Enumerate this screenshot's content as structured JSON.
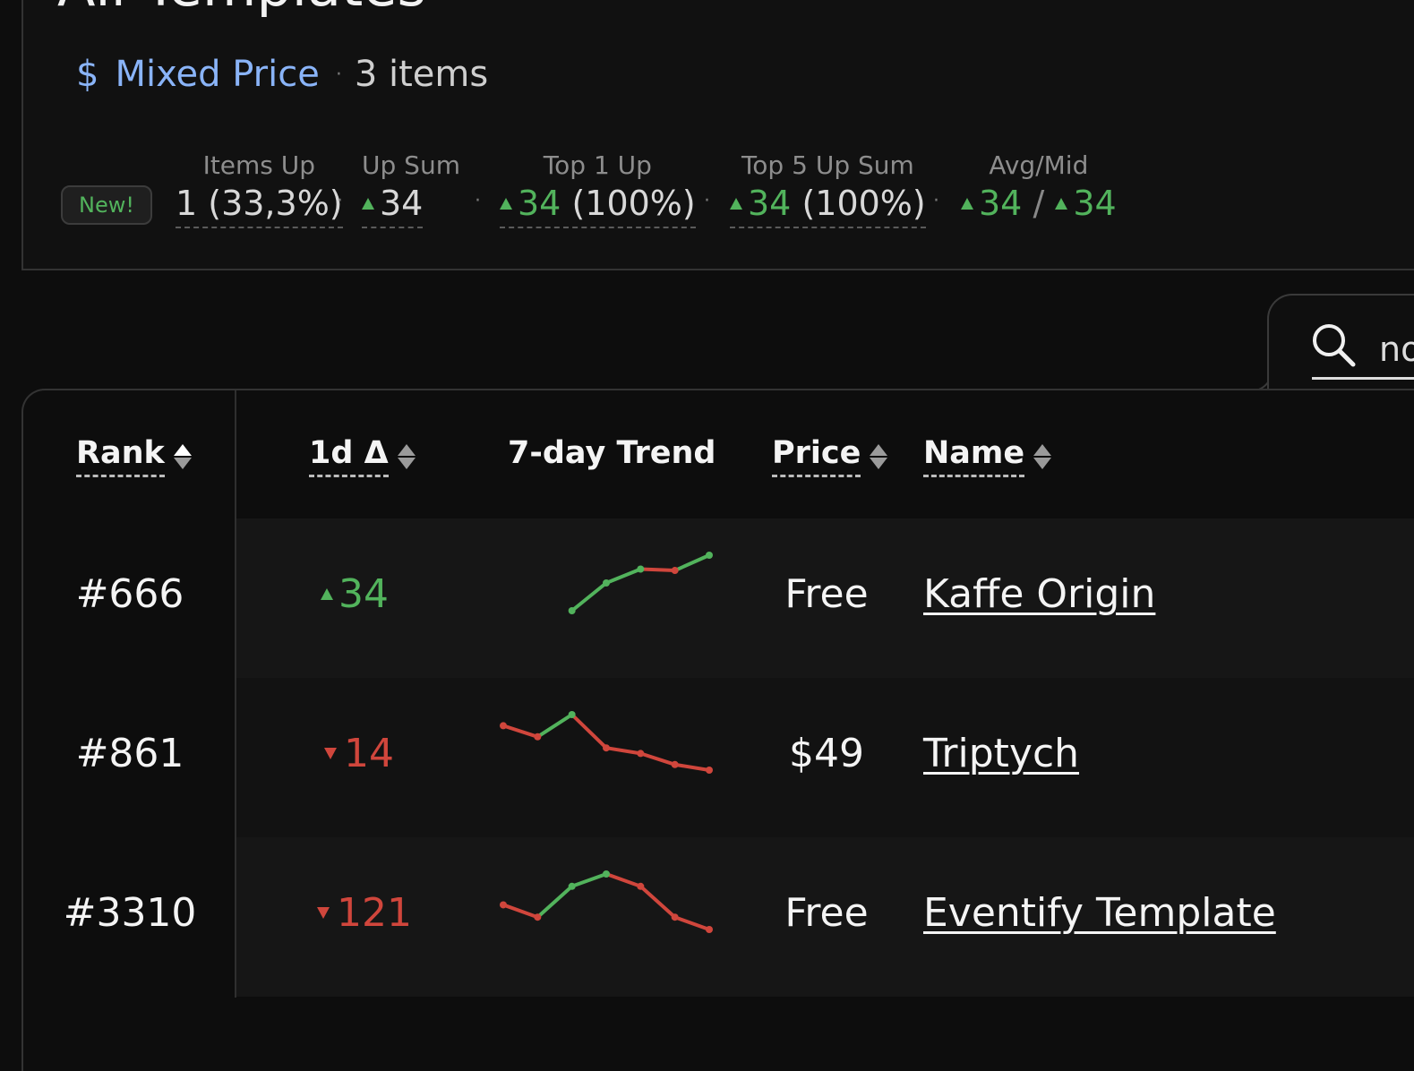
{
  "header": {
    "title": "All Templates",
    "price_icon": "$",
    "price_type": "Mixed Price",
    "separator": "·",
    "item_count": "3 items"
  },
  "badge": {
    "label": "New!"
  },
  "stats": [
    {
      "label": "Items Up",
      "value": "1 (33,3%)"
    },
    {
      "label": "Up Sum",
      "value": "34"
    },
    {
      "label": "Top 1 Up",
      "value": "34",
      "pct": "(100%)"
    },
    {
      "label": "Top 5 Up Sum",
      "value": "34",
      "pct": "(100%)"
    },
    {
      "label": "Avg/Mid",
      "avg": "34",
      "slash": "/",
      "mid": "34"
    }
  ],
  "search": {
    "value": "no",
    "icon": "search-icon"
  },
  "table": {
    "columns": [
      "Rank",
      "1d Δ",
      "7-day Trend",
      "Price",
      "Name"
    ],
    "rows": [
      {
        "rank": "#666",
        "delta": "34",
        "delta_dir": "up",
        "price": "Free",
        "name": "Kaffe Origin",
        "trend": [
          null,
          null,
          1,
          3,
          4,
          3.9,
          5
        ]
      },
      {
        "rank": "#861",
        "delta": "14",
        "delta_dir": "down",
        "price": "$49",
        "name": "Triptych",
        "trend": [
          4,
          3,
          5,
          2,
          1.5,
          0.5,
          0
        ]
      },
      {
        "rank": "#3310",
        "delta": "121",
        "delta_dir": "down",
        "price": "Free",
        "name": "Eventify Template",
        "trend": [
          2,
          1,
          3.5,
          4.5,
          3.5,
          1,
          0
        ]
      }
    ]
  },
  "colors": {
    "up": "#52b35c",
    "down": "#d0463c",
    "accent": "#8ab4f8"
  }
}
